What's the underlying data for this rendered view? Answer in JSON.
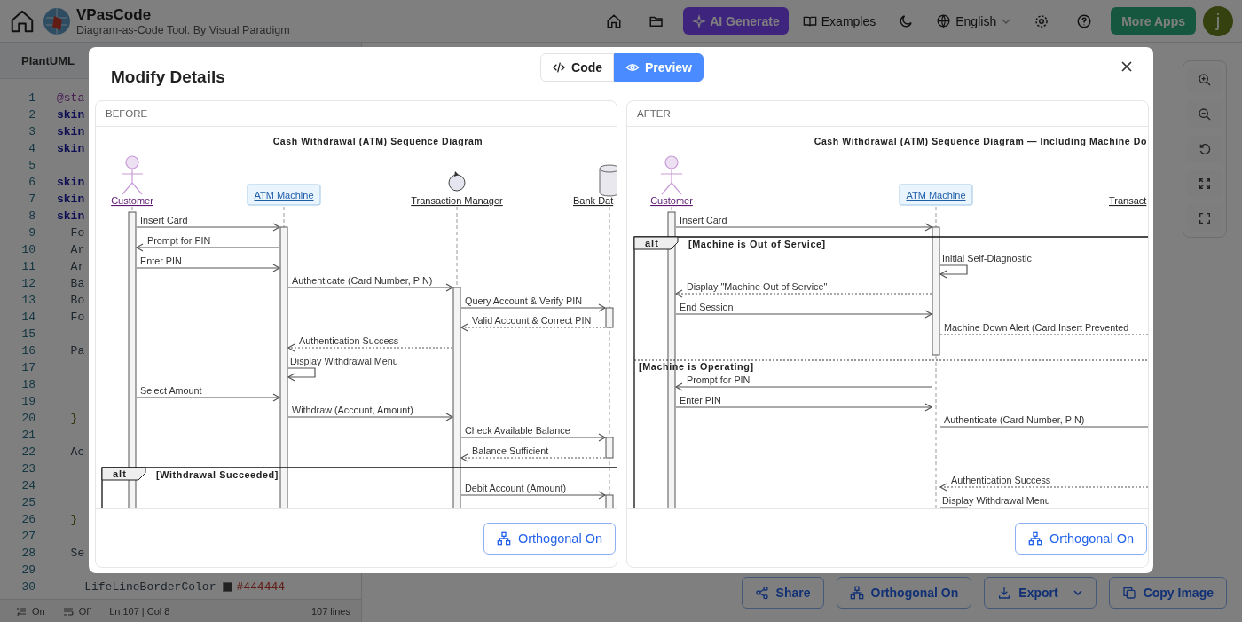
{
  "header": {
    "title": "VPasCode",
    "subtitle": "Diagram-as-Code Tool. By Visual Paradigm",
    "ai_button": "AI Generate",
    "examples": "Examples",
    "language": "English",
    "more_apps": "More Apps",
    "avatar": "j"
  },
  "editor": {
    "tab": "PlantUML",
    "lines": [
      {
        "number": "1",
        "kind": "directive",
        "text": "@sta"
      },
      {
        "number": "2",
        "kind": "keyword",
        "text": "skin"
      },
      {
        "number": "3",
        "kind": "keyword",
        "text": "skin"
      },
      {
        "number": "4",
        "kind": "keyword",
        "text": "skin"
      },
      {
        "number": "5"
      },
      {
        "number": "6",
        "kind": "keyword",
        "text": "skin"
      },
      {
        "number": "7",
        "kind": "keyword",
        "text": "skin"
      },
      {
        "number": "8",
        "kind": "keyword",
        "text": "skin"
      },
      {
        "number": "9",
        "kind": "plain",
        "text": "  Fo"
      },
      {
        "number": "10",
        "kind": "plain",
        "text": "  Ar"
      },
      {
        "number": "11",
        "kind": "plain",
        "text": "  Ar"
      },
      {
        "number": "12",
        "kind": "plain",
        "text": "  Ba"
      },
      {
        "number": "13",
        "kind": "plain",
        "text": "  Bo"
      },
      {
        "number": "14",
        "kind": "plain",
        "text": "  Fo"
      },
      {
        "number": "15"
      },
      {
        "number": "16",
        "kind": "plain",
        "text": "  Pa"
      },
      {
        "number": "17"
      },
      {
        "number": "18"
      },
      {
        "number": "19"
      },
      {
        "number": "20",
        "kind": "brace",
        "text": "  }"
      },
      {
        "number": "21"
      },
      {
        "number": "22",
        "kind": "plain",
        "text": "  Ac"
      },
      {
        "number": "23"
      },
      {
        "number": "24"
      },
      {
        "number": "25"
      },
      {
        "number": "26",
        "kind": "brace",
        "text": "  }"
      },
      {
        "number": "27"
      },
      {
        "number": "28",
        "kind": "plain",
        "text": "  Se"
      },
      {
        "number": "29"
      },
      {
        "number": "30",
        "kind": "plain",
        "text": "    LifeLineBorderColor",
        "color_value": "#444444"
      }
    ],
    "status": {
      "line_numbers": "On",
      "wrap": "Off",
      "position": "Ln 107 | Col 8",
      "count": "107 lines"
    }
  },
  "canvas_actions": [
    {
      "kind": "share",
      "label": "Share"
    },
    {
      "kind": "orthogonal",
      "label": "Orthogonal On"
    },
    {
      "kind": "export",
      "label": "Export"
    },
    {
      "kind": "copy",
      "label": "Copy Image"
    }
  ],
  "modal": {
    "title": "Modify Details",
    "modes": [
      {
        "kind": "code",
        "label": "Code",
        "selected": false
      },
      {
        "kind": "preview",
        "label": "Preview",
        "selected": true
      }
    ],
    "panels": [
      {
        "heading": "BEFORE",
        "button": "Orthogonal On",
        "diagram": {
          "title": "Cash Withdrawal (ATM) Sequence Diagram",
          "participants": [
            {
              "name": "Customer",
              "kind": "actor"
            },
            {
              "name": "ATM Machine",
              "kind": "boundary"
            },
            {
              "name": "Transaction Manager",
              "kind": "control"
            },
            {
              "name": "Bank Dat",
              "kind": "database"
            }
          ],
          "steps": [
            {
              "kind": "call",
              "label": "Insert Card"
            },
            {
              "kind": "call",
              "label": "Prompt for PIN"
            },
            {
              "kind": "call",
              "label": "Enter PIN"
            },
            {
              "kind": "call",
              "label": "Authenticate (Card Number, PIN)"
            },
            {
              "kind": "call",
              "label": "Query Account & Verify PIN"
            },
            {
              "kind": "reply",
              "label": "Valid Account & Correct PIN"
            },
            {
              "kind": "reply",
              "label": "Authentication Success"
            },
            {
              "kind": "self",
              "label": "Display Withdrawal Menu"
            },
            {
              "kind": "call",
              "label": "Select Amount"
            },
            {
              "kind": "call",
              "label": "Withdraw (Account, Amount)"
            },
            {
              "kind": "call",
              "label": "Check Available Balance"
            },
            {
              "kind": "reply",
              "label": "Balance Sufficient"
            },
            {
              "kind": "alt",
              "tag": "alt",
              "guard": "[Withdrawal Succeeded]"
            },
            {
              "kind": "call",
              "label": "Debit Account (Amount)"
            }
          ]
        }
      },
      {
        "heading": "AFTER",
        "button": "Orthogonal On",
        "diagram": {
          "title": "Cash Withdrawal (ATM) Sequence Diagram — Including Machine Do",
          "participants": [
            {
              "name": "Customer",
              "kind": "actor"
            },
            {
              "name": "ATM Machine",
              "kind": "boundary"
            },
            {
              "name": "Transact",
              "kind": "control"
            }
          ],
          "steps": [
            {
              "kind": "call",
              "label": "Insert Card"
            },
            {
              "kind": "alt",
              "tag": "alt",
              "guard": "[Machine is Out of Service]"
            },
            {
              "kind": "self",
              "label": "Initial Self-Diagnostic"
            },
            {
              "kind": "reply",
              "label": "Display \"Machine Out of Service\""
            },
            {
              "kind": "call",
              "label": "End Session"
            },
            {
              "kind": "reply",
              "label": "Machine Down Alert (Card Insert Prevented"
            },
            {
              "kind": "else",
              "guard": "[Machine is Operating]"
            },
            {
              "kind": "call",
              "label": "Prompt for PIN"
            },
            {
              "kind": "call",
              "label": "Enter PIN"
            },
            {
              "kind": "call",
              "label": "Authenticate (Card Number, PIN)"
            },
            {
              "kind": "reply",
              "label": "Authentication Success"
            },
            {
              "kind": "self",
              "label": "Display Withdrawal Menu"
            }
          ]
        }
      }
    ]
  }
}
